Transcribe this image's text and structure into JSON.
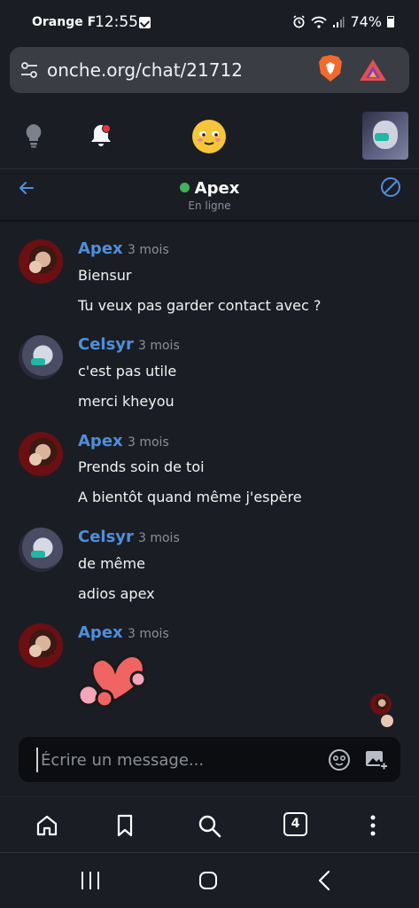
{
  "status_bar": {
    "carrier": "Orange F",
    "time": "12:55",
    "battery": "74%"
  },
  "browser": {
    "url": "onche.org/chat/21712",
    "tab_count": "4"
  },
  "chat_header": {
    "contact_name": "Apex",
    "contact_status": "En ligne"
  },
  "messages": [
    {
      "author": "Apex",
      "time": "3 mois",
      "lines": [
        "Biensur",
        "Tu veux pas garder contact avec ?"
      ]
    },
    {
      "author": "Celsyr",
      "time": "3 mois",
      "lines": [
        "c'est pas utile",
        "merci kheyou"
      ]
    },
    {
      "author": "Apex",
      "time": "3 mois",
      "lines": [
        "Prends soin de toi",
        "A bientôt quand même j'espère"
      ]
    },
    {
      "author": "Celsyr",
      "time": "3 mois",
      "lines": [
        "de même",
        "adios apex"
      ]
    },
    {
      "author": "Apex",
      "time": "3 mois",
      "lines": [],
      "sticker": "hearts-sticker"
    }
  ],
  "composer": {
    "placeholder": "Écrire un message..."
  },
  "colors": {
    "background": "#1b1d24",
    "author_name": "#4e8fdc",
    "online": "#43b25a",
    "notification_dot": "#e53935"
  }
}
